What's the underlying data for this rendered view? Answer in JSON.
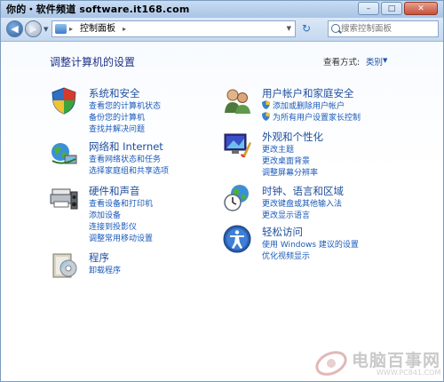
{
  "titlebar": {
    "watermark": "你的・软件频道 software.it168.com",
    "minimize_label": "–",
    "maximize_label": "□",
    "close_label": "✕"
  },
  "navbar": {
    "back_label": "◀",
    "forward_label": "▶",
    "breadcrumb": "控制面板",
    "breadcrumb_sep": "▸",
    "refresh_label": "↻",
    "search_placeholder": "搜索控制面板"
  },
  "page": {
    "title": "调整计算机的设置",
    "view_by_label": "查看方式:",
    "view_by_value": "类别"
  },
  "left_categories": [
    {
      "icon": "system-security-icon",
      "title": "系统和安全",
      "links": [
        "查看您的计算机状态",
        "备份您的计算机",
        "查找并解决问题"
      ]
    },
    {
      "icon": "network-internet-icon",
      "title": "网络和 Internet",
      "links": [
        "查看网络状态和任务",
        "选择家庭组和共享选项"
      ]
    },
    {
      "icon": "hardware-sound-icon",
      "title": "硬件和声音",
      "links": [
        "查看设备和打印机",
        "添加设备",
        "连接到投影仪",
        "调整常用移动设置"
      ]
    },
    {
      "icon": "programs-icon",
      "title": "程序",
      "links": [
        "卸载程序"
      ]
    }
  ],
  "right_categories": [
    {
      "icon": "user-accounts-icon",
      "title": "用户帐户和家庭安全",
      "links": [
        "添加或删除用户帐户",
        "为所有用户设置家长控制"
      ]
    },
    {
      "icon": "appearance-icon",
      "title": "外观和个性化",
      "links": [
        "更改主题",
        "更改桌面背景",
        "调整屏幕分辨率"
      ]
    },
    {
      "icon": "clock-language-region-icon",
      "title": "时钟、语言和区域",
      "links": [
        "更改键盘或其他输入法",
        "更改显示语言"
      ]
    },
    {
      "icon": "ease-of-access-icon",
      "title": "轻松访问",
      "links": [
        "使用 Windows 建议的设置",
        "优化视频显示"
      ]
    }
  ],
  "watermark_logo": {
    "text": "电脑百事网",
    "sub": "WWW.PC841.COM"
  }
}
